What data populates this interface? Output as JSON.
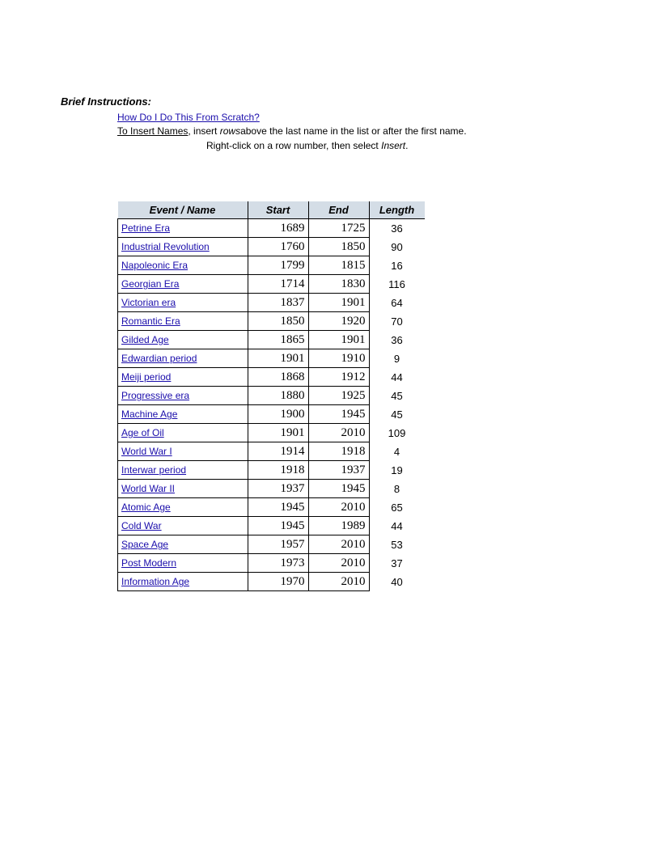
{
  "heading": "Brief Instructions:",
  "instructions": {
    "link": "How Do I Do This From Scratch?",
    "line1_underlined": "To Insert Names",
    "line1_text1": ", insert ",
    "line1_italic": "rows",
    "line1_text2": "above the last name in the list or after the first name.",
    "line2_text1": "Right-click on a row number, then select   ",
    "line2_italic": "Insert",
    "line2_text2": "."
  },
  "table": {
    "headers": {
      "name": "Event / Name",
      "start": "Start",
      "end": "End",
      "length": "Length"
    },
    "rows": [
      {
        "name": "Petrine Era",
        "start": 1689,
        "end": 1725,
        "length": 36
      },
      {
        "name": "Industrial Revolution",
        "start": 1760,
        "end": 1850,
        "length": 90
      },
      {
        "name": "Napoleonic Era",
        "start": 1799,
        "end": 1815,
        "length": 16
      },
      {
        "name": "Georgian Era",
        "start": 1714,
        "end": 1830,
        "length": 116
      },
      {
        "name": "Victorian era",
        "start": 1837,
        "end": 1901,
        "length": 64
      },
      {
        "name": "Romantic Era",
        "start": 1850,
        "end": 1920,
        "length": 70
      },
      {
        "name": "Gilded Age",
        "start": 1865,
        "end": 1901,
        "length": 36
      },
      {
        "name": "Edwardian period",
        "start": 1901,
        "end": 1910,
        "length": 9
      },
      {
        "name": "Meiji period",
        "start": 1868,
        "end": 1912,
        "length": 44
      },
      {
        "name": "Progressive era",
        "start": 1880,
        "end": 1925,
        "length": 45
      },
      {
        "name": "Machine Age",
        "start": 1900,
        "end": 1945,
        "length": 45
      },
      {
        "name": "Age of Oil",
        "start": 1901,
        "end": 2010,
        "length": 109
      },
      {
        "name": "World War I",
        "start": 1914,
        "end": 1918,
        "length": 4
      },
      {
        "name": "Interwar period",
        "start": 1918,
        "end": 1937,
        "length": 19
      },
      {
        "name": "World War II",
        "start": 1937,
        "end": 1945,
        "length": 8
      },
      {
        "name": "Atomic Age",
        "start": 1945,
        "end": 2010,
        "length": 65
      },
      {
        "name": "Cold War",
        "start": 1945,
        "end": 1989,
        "length": 44
      },
      {
        "name": "Space Age",
        "start": 1957,
        "end": 2010,
        "length": 53
      },
      {
        "name": "Post Modern",
        "start": 1973,
        "end": 2010,
        "length": 37
      },
      {
        "name": "Information Age",
        "start": 1970,
        "end": 2010,
        "length": 40
      }
    ]
  }
}
